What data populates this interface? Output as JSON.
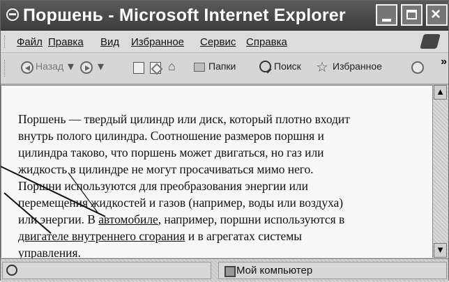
{
  "window": {
    "title": "Поршень - Microsoft Internet Explorer"
  },
  "menubar": {
    "items": [
      "Файл",
      "Правка",
      "Вид",
      "Избранное",
      "Сервис",
      "Справка"
    ]
  },
  "toolbar": {
    "back_label": "Назад",
    "folders_label": "Папки",
    "search_label": "Поиск",
    "favorites_label": "Избранное",
    "more_label": "»"
  },
  "content": {
    "line1": "Поршень — твердый цилиндр или диск, который плотно входит",
    "line2": "внутрь полого цилиндра. Соотношение размеров поршня и",
    "line3": "цилиндра таково, что поршень может двигаться, но газ или",
    "line4": "жидкость в цилиндре не могут просачиваться мимо него.",
    "line5": "Поршни используются для преобразования энергии или",
    "line6": "перемещения жидкостей и газов (например, воды или воздуха)",
    "line7_before": "или энергии. В ",
    "line7_link": "автомобиле",
    "line7_after": ", например, поршни используются в",
    "line8_link": "двигателе внутреннего сгорания",
    "line8_after": " и в агрегатах системы",
    "line9": "управления."
  },
  "statusbar": {
    "zone_label": "Мой компьютер"
  },
  "colors": {
    "titlebar": "#4a4a4a",
    "content_bg": "#f7f7f7",
    "chrome_bg": "#d8d8d8"
  },
  "icons": [
    "app-icon",
    "brand-icon",
    "back-icon",
    "forward-icon",
    "stop-icon",
    "refresh-icon",
    "home-icon",
    "folders-icon",
    "search-icon",
    "favorites-icon",
    "media-icon",
    "scroll-up-icon",
    "scroll-down-icon",
    "globe-icon",
    "computer-icon"
  ]
}
